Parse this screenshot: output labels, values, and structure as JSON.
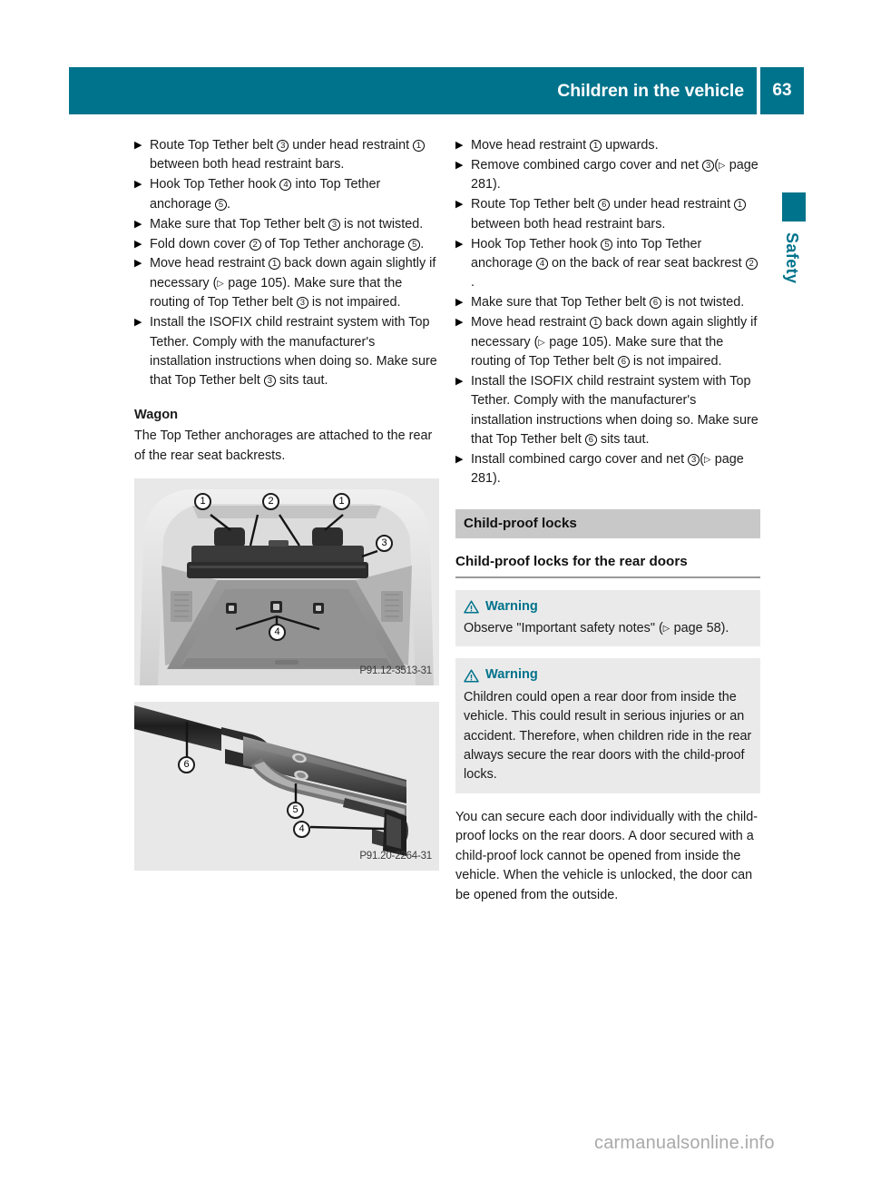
{
  "header": {
    "title": "Children in the vehicle",
    "page_number": "63",
    "accent_color": "#00738c"
  },
  "side_tab": {
    "label": "Safety",
    "color": "#00738c"
  },
  "left_column": {
    "steps": [
      {
        "parts": [
          {
            "t": "text",
            "v": "Route Top Tether belt "
          },
          {
            "t": "cn",
            "v": "3"
          },
          {
            "t": "text",
            "v": " under head restraint "
          },
          {
            "t": "cn",
            "v": "1"
          },
          {
            "t": "text",
            "v": " between both head restraint bars."
          }
        ]
      },
      {
        "parts": [
          {
            "t": "text",
            "v": "Hook Top Tether hook "
          },
          {
            "t": "cn",
            "v": "4"
          },
          {
            "t": "text",
            "v": " into Top Tether anchorage "
          },
          {
            "t": "cn",
            "v": "5"
          },
          {
            "t": "text",
            "v": "."
          }
        ]
      },
      {
        "parts": [
          {
            "t": "text",
            "v": "Make sure that Top Tether belt "
          },
          {
            "t": "cn",
            "v": "3"
          },
          {
            "t": "text",
            "v": " is not twisted."
          }
        ]
      },
      {
        "parts": [
          {
            "t": "text",
            "v": "Fold down cover "
          },
          {
            "t": "cn",
            "v": "2"
          },
          {
            "t": "text",
            "v": " of Top Tether anchorage "
          },
          {
            "t": "cn",
            "v": "5"
          },
          {
            "t": "text",
            "v": "."
          }
        ]
      },
      {
        "parts": [
          {
            "t": "text",
            "v": "Move head restraint "
          },
          {
            "t": "cn",
            "v": "1"
          },
          {
            "t": "text",
            "v": " back down again slightly if necessary ("
          },
          {
            "t": "xref",
            "v": "▷"
          },
          {
            "t": "text",
            "v": " page 105). Make sure that the routing of Top Tether belt "
          },
          {
            "t": "cn",
            "v": "3"
          },
          {
            "t": "text",
            "v": " is not impaired."
          }
        ]
      },
      {
        "parts": [
          {
            "t": "text",
            "v": "Install the ISOFIX child restraint system with Top Tether. Comply with the manufacturer's installation instructions when doing so. Make sure that Top Tether belt "
          },
          {
            "t": "cn",
            "v": "3"
          },
          {
            "t": "text",
            "v": " sits taut."
          }
        ]
      }
    ],
    "wagon_heading": "Wagon",
    "wagon_text": "The Top Tether anchorages are attached to the rear of the rear seat backrests.",
    "figures": [
      {
        "caption": "P91.12-3513-31",
        "alt": "wagon-cargo-area-top-tether-anchorages",
        "callouts": [
          "1",
          "2",
          "1",
          "3",
          "4"
        ]
      },
      {
        "caption": "P91.20-2264-31",
        "alt": "top-tether-belt-hook-detail",
        "callouts": [
          "6",
          "5",
          "4"
        ]
      }
    ]
  },
  "right_column": {
    "steps": [
      {
        "parts": [
          {
            "t": "text",
            "v": "Move head restraint "
          },
          {
            "t": "cn",
            "v": "1"
          },
          {
            "t": "text",
            "v": " upwards."
          }
        ]
      },
      {
        "parts": [
          {
            "t": "text",
            "v": "Remove combined cargo cover and net "
          },
          {
            "t": "cn",
            "v": "3"
          },
          {
            "t": "text",
            "v": "("
          },
          {
            "t": "xref",
            "v": "▷"
          },
          {
            "t": "text",
            "v": " page 281)."
          }
        ]
      },
      {
        "parts": [
          {
            "t": "text",
            "v": "Route Top Tether belt "
          },
          {
            "t": "cn",
            "v": "6"
          },
          {
            "t": "text",
            "v": " under head restraint "
          },
          {
            "t": "cn",
            "v": "1"
          },
          {
            "t": "text",
            "v": " between both head restraint bars."
          }
        ]
      },
      {
        "parts": [
          {
            "t": "text",
            "v": "Hook Top Tether hook "
          },
          {
            "t": "cn",
            "v": "5"
          },
          {
            "t": "text",
            "v": " into Top Tether anchorage "
          },
          {
            "t": "cn",
            "v": "4"
          },
          {
            "t": "text",
            "v": " on the back of rear seat backrest "
          },
          {
            "t": "cn",
            "v": "2"
          },
          {
            "t": "text",
            "v": "."
          }
        ]
      },
      {
        "parts": [
          {
            "t": "text",
            "v": "Make sure that Top Tether belt "
          },
          {
            "t": "cn",
            "v": "6"
          },
          {
            "t": "text",
            "v": " is not twisted."
          }
        ]
      },
      {
        "parts": [
          {
            "t": "text",
            "v": "Move head restraint "
          },
          {
            "t": "cn",
            "v": "1"
          },
          {
            "t": "text",
            "v": " back down again slightly if necessary ("
          },
          {
            "t": "xref",
            "v": "▷"
          },
          {
            "t": "text",
            "v": " page 105). Make sure that the routing of Top Tether belt "
          },
          {
            "t": "cn",
            "v": "6"
          },
          {
            "t": "text",
            "v": " is not impaired."
          }
        ]
      },
      {
        "parts": [
          {
            "t": "text",
            "v": "Install the ISOFIX child restraint system with Top Tether. Comply with the manufacturer's installation instructions when doing so. Make sure that Top Tether belt "
          },
          {
            "t": "cn",
            "v": "6"
          },
          {
            "t": "text",
            "v": " sits taut."
          }
        ]
      },
      {
        "parts": [
          {
            "t": "text",
            "v": "Install combined cargo cover and net "
          },
          {
            "t": "cn",
            "v": "3"
          },
          {
            "t": "text",
            "v": "("
          },
          {
            "t": "xref",
            "v": "▷"
          },
          {
            "t": "text",
            "v": " page 281)."
          }
        ]
      }
    ],
    "section_title": "Child-proof locks",
    "section_subtitle": "Child-proof locks for the rear doors",
    "warnings": [
      {
        "title": "Warning",
        "body_parts": [
          {
            "t": "text",
            "v": "Observe \"Important safety notes\" ("
          },
          {
            "t": "xref",
            "v": "▷"
          },
          {
            "t": "text",
            "v": " page 58)."
          }
        ]
      },
      {
        "title": "Warning",
        "body_parts": [
          {
            "t": "text",
            "v": "Children could open a rear door from inside the vehicle. This could result in serious injuries or an accident. Therefore, when children ride in the rear always secure the rear doors with the child-proof locks."
          }
        ]
      }
    ],
    "closing_paragraph": "You can secure each door individually with the child-proof locks on the rear doors. A door secured with a child-proof lock cannot be opened from inside the vehicle. When the vehicle is unlocked, the door can be opened from the outside."
  },
  "watermark": "carmanualsonline.info",
  "bullet_glyph": "▶"
}
